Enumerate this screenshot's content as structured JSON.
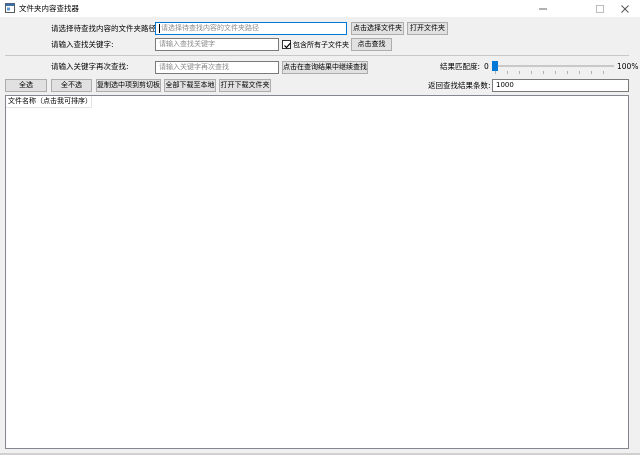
{
  "window": {
    "title": "文件夹内容查找器",
    "icon": "app-window-icon",
    "controls": {
      "minimize": "–",
      "maximize": "☐",
      "close": "✕"
    }
  },
  "row1": {
    "label": "请选择待查找内容的文件夹路径:",
    "path_placeholder": "请选择待查找内容的文件夹路径",
    "choose_button": "点击选择文件夹",
    "open_button": "打开文件夹"
  },
  "row2": {
    "label": "请输入查找关键字:",
    "keyword_placeholder": "请输入查找关键字",
    "include_subfolders_label": "包含所有子文件夹",
    "include_subfolders_checked": true,
    "search_button": "点击查找"
  },
  "row3": {
    "label": "请输入关键字再次查找:",
    "keyword2_placeholder": "请输入关键字再次查找",
    "search_again_button": "点击在查询结果中继续查找",
    "match_label": "结果匹配度:",
    "match_min": "0",
    "match_max": "100%",
    "match_value": 0
  },
  "toolbar": {
    "select_all": "全选",
    "select_none": "全不选",
    "copy_to_clipboard": "复制选中项到剪切板",
    "download_all": "全部下载至本地",
    "open_download_folder": "打开下载文件夹",
    "result_count_label": "返回查找结果条数:",
    "result_count_value": "1000"
  },
  "results": {
    "columns": [
      "文件名称（点击我可排序）"
    ],
    "rows": []
  }
}
